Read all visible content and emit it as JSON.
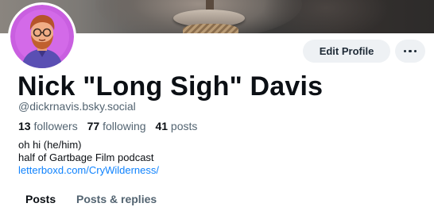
{
  "profile": {
    "display_name": "Nick \"Long Sigh\" Davis",
    "handle": "@dickrnavis.bsky.social",
    "stats": {
      "followers_count": "13",
      "followers_label": "followers",
      "following_count": "77",
      "following_label": "following",
      "posts_count": "41",
      "posts_label": "posts"
    },
    "bio": {
      "line1": "oh hi (he/him)",
      "line2": "half of Gartbage Film podcast",
      "link": "letterboxd.com/CryWilderness/"
    }
  },
  "actions": {
    "edit_profile_label": "Edit Profile",
    "more_icon": "ellipsis-icon"
  },
  "tabs": [
    {
      "label": "Posts",
      "active": true
    },
    {
      "label": "Posts & replies",
      "active": false
    }
  ],
  "colors": {
    "link": "#1083fe",
    "muted": "#536471",
    "button_bg": "#eef1f4"
  }
}
